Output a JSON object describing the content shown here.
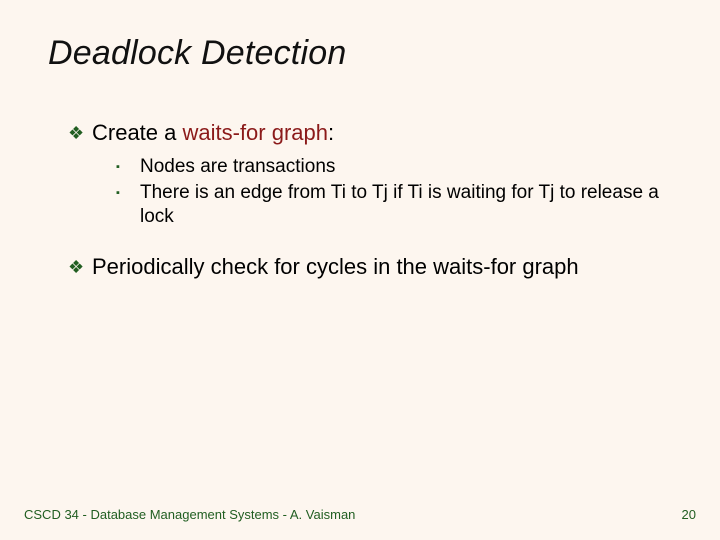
{
  "title": "Deadlock Detection",
  "bullets": [
    {
      "prefix": "Create a ",
      "emph": "waits-for graph",
      "suffix": ":",
      "sub": [
        "Nodes are transactions",
        "There is an edge from Ti to Tj if Ti is waiting for Tj to release a lock"
      ]
    },
    {
      "prefix": "Periodically check for cycles in the waits-for graph",
      "emph": "",
      "suffix": "",
      "sub": []
    }
  ],
  "footer": {
    "left": "CSCD 34 - Database Management Systems - A. Vaisman",
    "right": "20"
  },
  "glyphs": {
    "diamond": "❖",
    "square": "▪"
  }
}
